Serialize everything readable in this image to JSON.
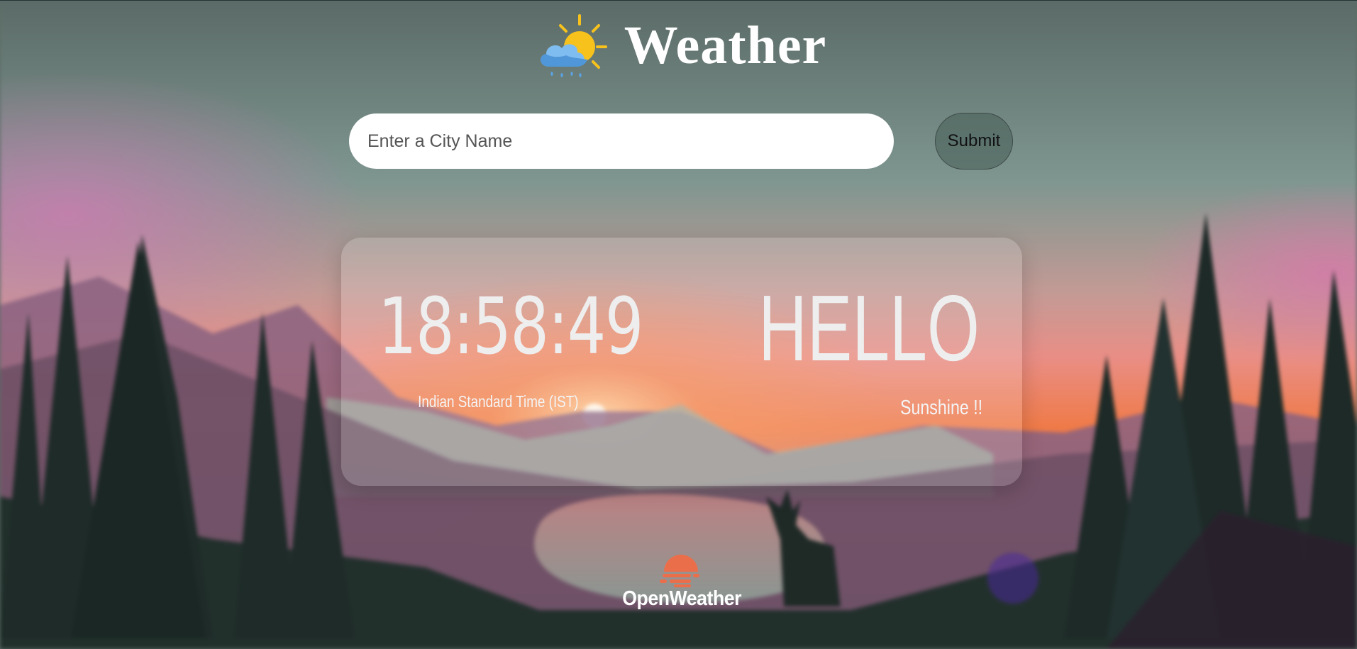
{
  "header": {
    "title": "Weather",
    "icon": "sun-cloud-rain-icon"
  },
  "search": {
    "placeholder": "Enter a City Name",
    "value": "",
    "submit_label": "Submit"
  },
  "clock": {
    "time": "18:58:49",
    "timezone": "Indian Standard Time (IST)"
  },
  "greeting": {
    "title": "HELLO",
    "subtitle": "Sunshine !!"
  },
  "footer": {
    "brand": "OpenWeather",
    "brand_icon": "openweather-logo-icon"
  },
  "colors": {
    "sky_top": "#5c6e6a",
    "sunset_pink": "#e98a82",
    "sunset_orange": "#f0793f",
    "mountain_purple": "#8a5f78",
    "forest_dark": "#1c2a27",
    "brand_orange": "#eb6e4b",
    "sun_yellow": "#f8c21d",
    "cloud_blue": "#6fb3ec"
  }
}
